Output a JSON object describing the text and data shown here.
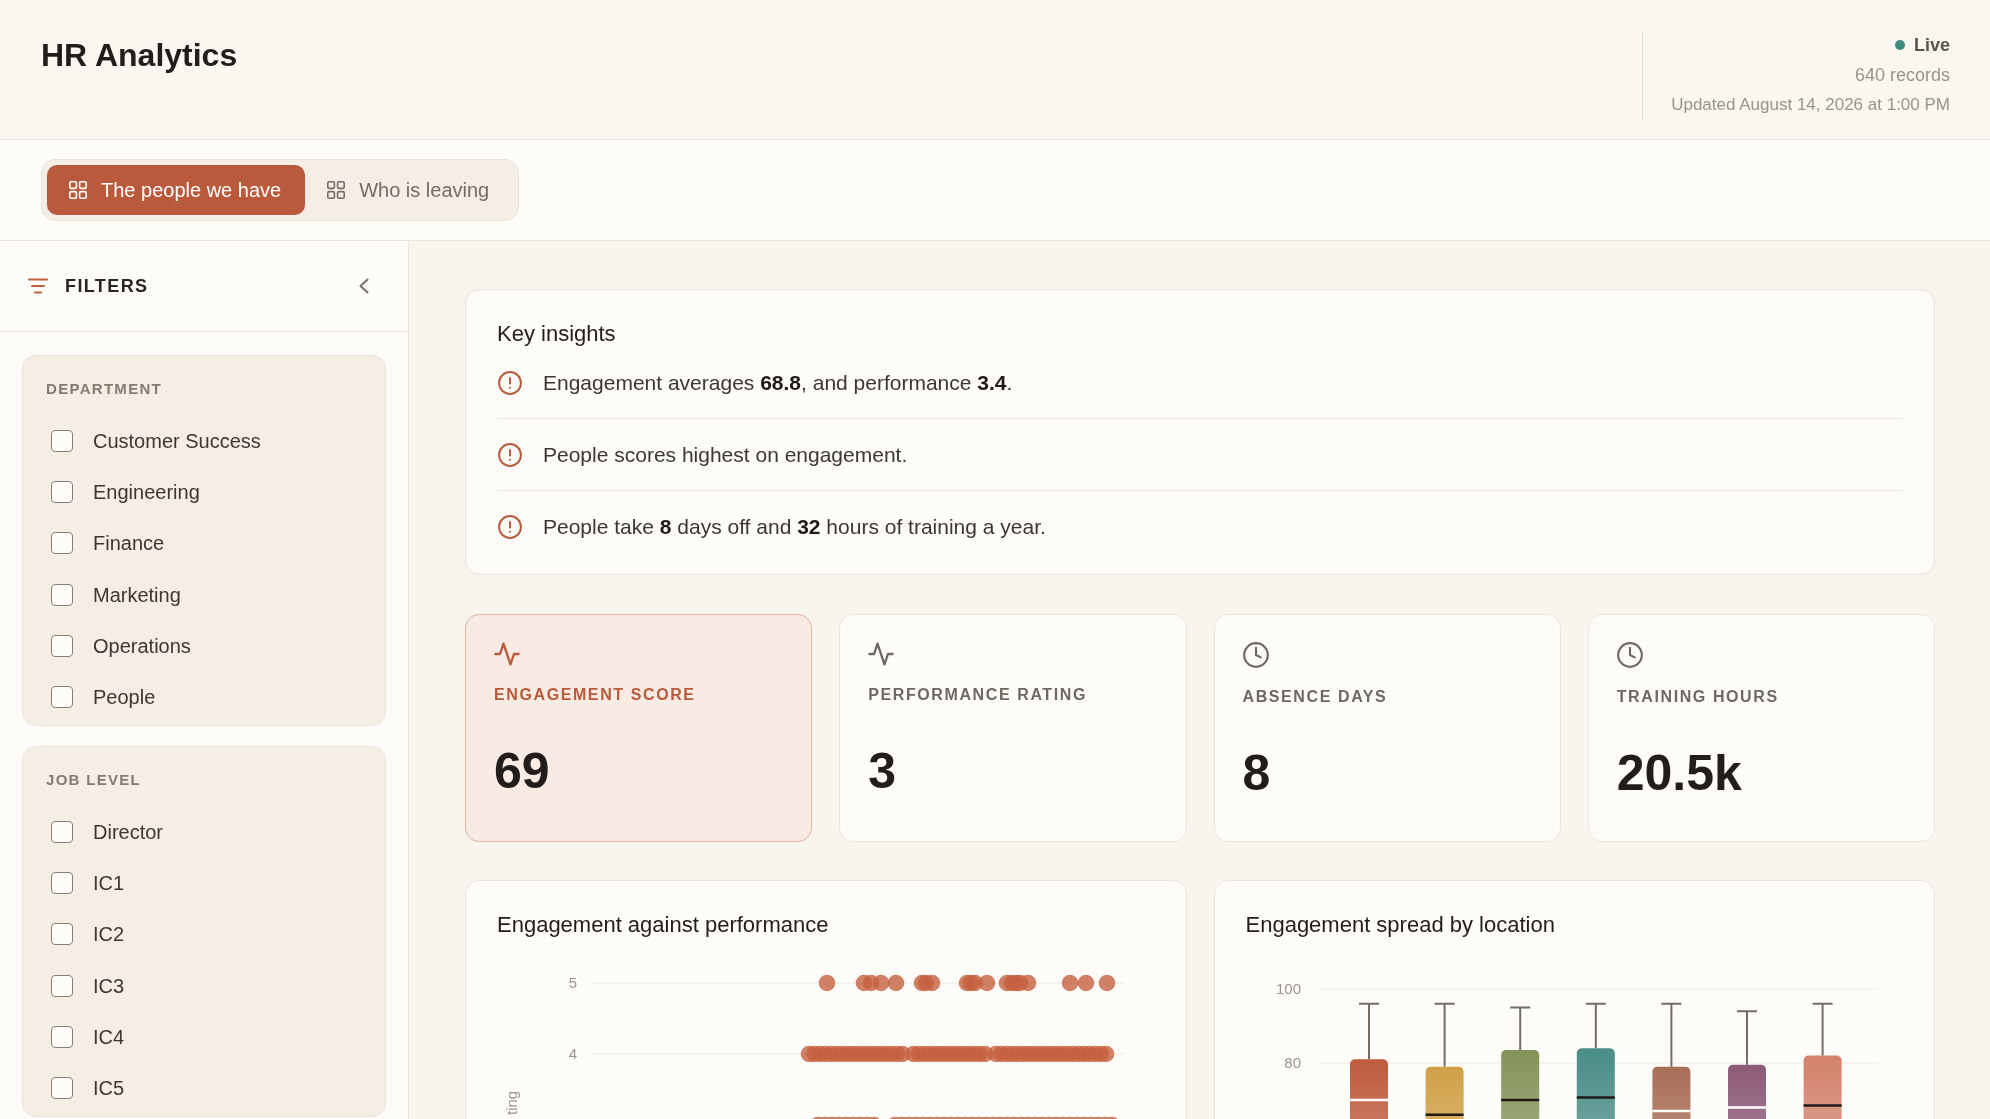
{
  "header": {
    "title": "HR Analytics",
    "status": "Live",
    "records": "640 records",
    "updated": "Updated August 14, 2026 at 1:00 PM"
  },
  "tabs": [
    {
      "label": "The people we have",
      "selected": true
    },
    {
      "label": "Who is leaving",
      "selected": false
    }
  ],
  "sidebar": {
    "title": "FILTERS",
    "groups": [
      {
        "title": "DEPARTMENT",
        "options": [
          {
            "label": "Customer Success",
            "checked": false
          },
          {
            "label": "Engineering",
            "checked": false
          },
          {
            "label": "Finance",
            "checked": false
          },
          {
            "label": "Marketing",
            "checked": false
          },
          {
            "label": "Operations",
            "checked": false
          },
          {
            "label": "People",
            "checked": false
          }
        ]
      },
      {
        "title": "JOB LEVEL",
        "options": [
          {
            "label": "Director",
            "checked": false
          },
          {
            "label": "IC1",
            "checked": false
          },
          {
            "label": "IC2",
            "checked": false
          },
          {
            "label": "IC3",
            "checked": false
          },
          {
            "label": "IC4",
            "checked": false
          },
          {
            "label": "IC5",
            "checked": false
          }
        ]
      }
    ]
  },
  "insights": {
    "title": "Key insights",
    "items": [
      "Engagement averages **68.8**, and performance **3.4**.",
      "People scores highest on engagement.",
      "People take **8** days off and **32** hours of training a year."
    ]
  },
  "kpis": [
    {
      "kind": "pulse",
      "label": "ENGAGEMENT SCORE",
      "value": "69",
      "selected": true
    },
    {
      "kind": "pulse",
      "label": "PERFORMANCE RATING",
      "value": "3",
      "selected": false
    },
    {
      "kind": "clock",
      "label": "ABSENCE DAYS",
      "value": "8",
      "selected": false
    },
    {
      "kind": "clock",
      "label": "TRAINING HOURS",
      "value": "20.5k",
      "selected": false
    }
  ],
  "charts": [
    {
      "kind": "scatter",
      "title": "Engagement against performance",
      "y_ticks": [
        "5",
        "4"
      ],
      "y_label": "ting"
    },
    {
      "kind": "boxplot",
      "title": "Engagement spread by location",
      "y_ticks": [
        "100",
        "80"
      ],
      "boxes": [
        {
          "color": "#bf5b3e"
        },
        {
          "color": "#d1a148"
        },
        {
          "color": "#84935a"
        },
        {
          "color": "#4a8d87"
        },
        {
          "color": "#a86e58"
        },
        {
          "color": "#8d5b79"
        },
        {
          "color": "#d3836b"
        }
      ]
    }
  ]
}
